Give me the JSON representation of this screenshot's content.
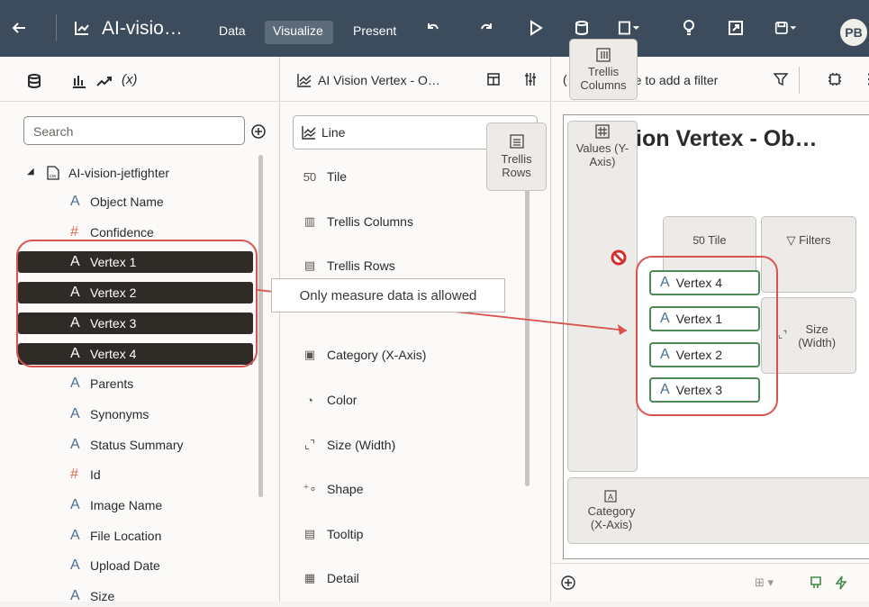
{
  "toolbar": {
    "title": "AI-visio…",
    "tabs": [
      "Data",
      "Visualize",
      "Present"
    ],
    "avatar": "PB"
  },
  "left_panel": {
    "search_placeholder": "Search",
    "dataset_name": "AI-vision-jetfighter",
    "fields": [
      {
        "type": "A",
        "label": "Object Name",
        "selected": false
      },
      {
        "type": "#",
        "label": "Confidence",
        "selected": false
      },
      {
        "type": "A",
        "label": "Vertex 1",
        "selected": true
      },
      {
        "type": "A",
        "label": "Vertex 2",
        "selected": true
      },
      {
        "type": "A",
        "label": "Vertex 3",
        "selected": true
      },
      {
        "type": "A",
        "label": "Vertex 4",
        "selected": true
      },
      {
        "type": "A",
        "label": "Parents",
        "selected": false
      },
      {
        "type": "A",
        "label": "Synonyms",
        "selected": false
      },
      {
        "type": "A",
        "label": "Status Summary",
        "selected": false
      },
      {
        "type": "#",
        "label": "Id",
        "selected": false
      },
      {
        "type": "A",
        "label": "Image Name",
        "selected": false
      },
      {
        "type": "A",
        "label": "File Location",
        "selected": false
      },
      {
        "type": "A",
        "label": "Upload Date",
        "selected": false
      },
      {
        "type": "A",
        "label": "Size",
        "selected": false
      }
    ]
  },
  "middle_panel": {
    "header_title": "AI Vision Vertex - O…",
    "viz_type": "Line",
    "grammar": [
      "Tile",
      "Trellis Columns",
      "Trellis Rows",
      "Category (X-Axis)",
      "Color",
      "Size (Width)",
      "Shape",
      "Tooltip",
      "Detail"
    ]
  },
  "right_panel": {
    "filter_text": "re to add a filter",
    "canvas_title": "AI Vision Vertex - Ob…",
    "title_overlap_letters": "AI",
    "drop_targets": {
      "trellis_columns": "Trellis Columns",
      "trellis_rows": "Trellis Rows",
      "values": "Values (Y-Axis)",
      "tile": "Tile",
      "filters": "Filters",
      "size": "Size (Width)",
      "category": "Category (X-Axis)"
    },
    "dragged_chips": [
      "Vertex 4",
      "Vertex 1",
      "Vertex 2",
      "Vertex 3"
    ]
  },
  "tooltip": "Only measure data is allowed",
  "colors": {
    "toolbar_bg": "#3c4c5c",
    "selected_field_bg": "#2f2c28",
    "highlight_red": "#d9534f",
    "chip_border": "#4e8a58"
  }
}
